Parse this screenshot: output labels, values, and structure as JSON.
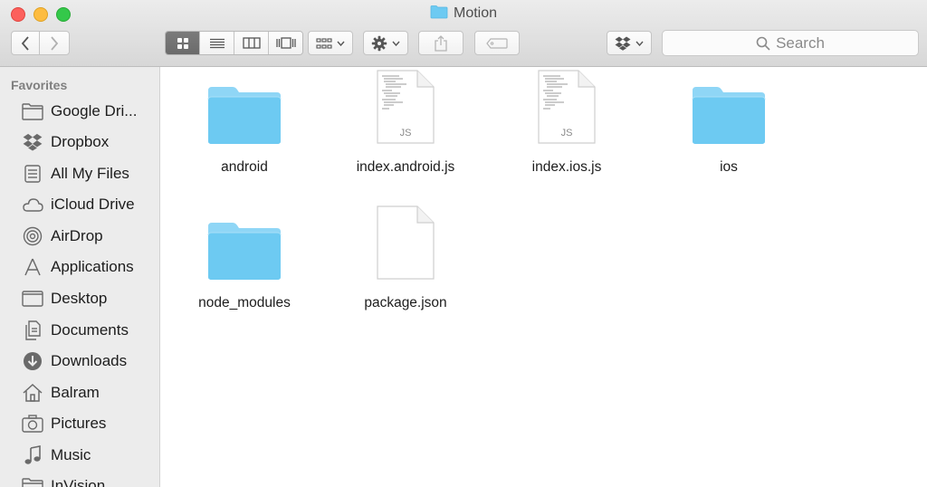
{
  "window": {
    "title": "Motion"
  },
  "toolbar": {
    "back_icon": "chevron-left-icon",
    "forward_icon": "chevron-right-icon",
    "view_modes": [
      "icon-view-icon",
      "list-view-icon",
      "column-view-icon",
      "coverflow-view-icon"
    ],
    "arrange_icon": "arrange-grid-icon",
    "action_icon": "gear-icon",
    "share_icon": "share-icon",
    "tag_icon": "tag-icon",
    "dropbox_icon": "dropbox-icon",
    "search_placeholder": "Search"
  },
  "sidebar": {
    "heading": "Favorites",
    "items": [
      {
        "label": "Google Dri...",
        "icon": "folder-icon"
      },
      {
        "label": "Dropbox",
        "icon": "dropbox-icon"
      },
      {
        "label": "All My Files",
        "icon": "all-files-icon"
      },
      {
        "label": "iCloud Drive",
        "icon": "cloud-icon"
      },
      {
        "label": "AirDrop",
        "icon": "airdrop-icon"
      },
      {
        "label": "Applications",
        "icon": "applications-icon"
      },
      {
        "label": "Desktop",
        "icon": "desktop-icon"
      },
      {
        "label": "Documents",
        "icon": "documents-icon"
      },
      {
        "label": "Downloads",
        "icon": "downloads-icon"
      },
      {
        "label": "Balram",
        "icon": "home-icon"
      },
      {
        "label": "Pictures",
        "icon": "camera-icon"
      },
      {
        "label": "Music",
        "icon": "music-note-icon"
      },
      {
        "label": "InVision",
        "icon": "folder-icon"
      }
    ]
  },
  "files": [
    {
      "name": "android",
      "kind": "folder"
    },
    {
      "name": "index.android.js",
      "kind": "js",
      "badge": "JS"
    },
    {
      "name": "index.ios.js",
      "kind": "js",
      "badge": "JS"
    },
    {
      "name": "ios",
      "kind": "folder"
    },
    {
      "name": "node_modules",
      "kind": "folder"
    },
    {
      "name": "package.json",
      "kind": "doc"
    }
  ],
  "colors": {
    "folder": "#6dcaf2",
    "folder_tab": "#8fd6f6",
    "accent_close": "#fc605c",
    "accent_min": "#fdbc40",
    "accent_max": "#34c84a"
  }
}
